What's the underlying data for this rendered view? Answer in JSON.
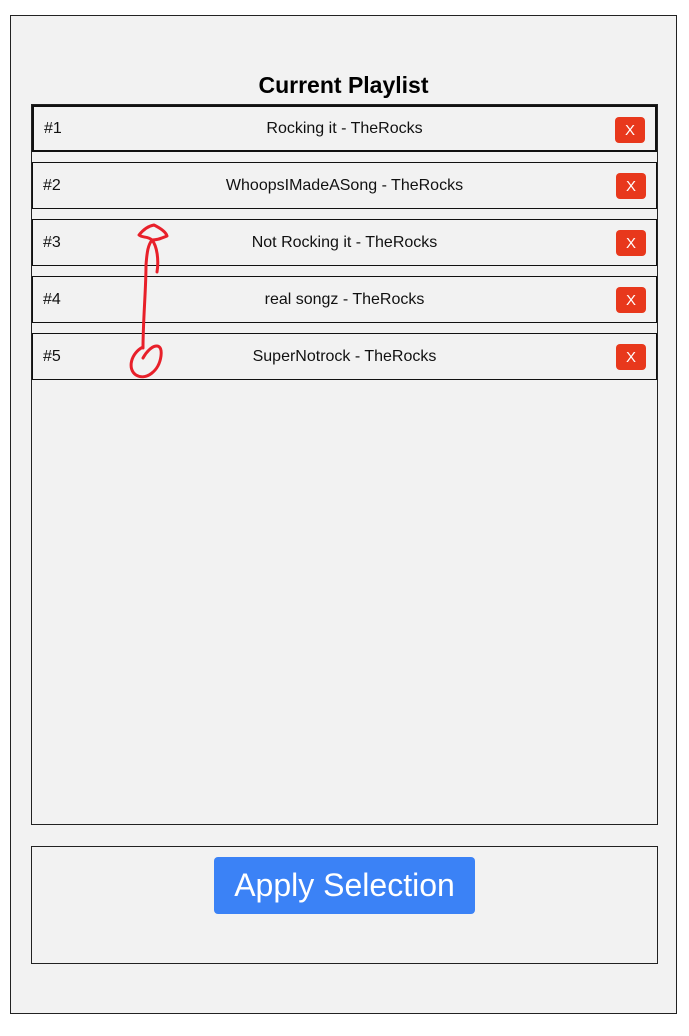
{
  "playlist": {
    "title": "Current Playlist",
    "items": [
      {
        "number": "#1",
        "label": "Rocking it - TheRocks",
        "remove_label": "X"
      },
      {
        "number": "#2",
        "label": "WhoopsIMadeASong - TheRocks",
        "remove_label": "X"
      },
      {
        "number": "#3",
        "label": "Not Rocking it - TheRocks",
        "remove_label": "X"
      },
      {
        "number": "#4",
        "label": "real songz - TheRocks",
        "remove_label": "X"
      },
      {
        "number": "#5",
        "label": "SuperNotrock - TheRocks",
        "remove_label": "X"
      }
    ]
  },
  "actions": {
    "apply_label": "Apply Selection"
  },
  "colors": {
    "background": "#f2f2f2",
    "remove_button": "#e8381c",
    "apply_button": "#3b82f6",
    "annotation_stroke": "#e8202a"
  },
  "icons": {
    "annotation": "drag-arrow-icon"
  }
}
